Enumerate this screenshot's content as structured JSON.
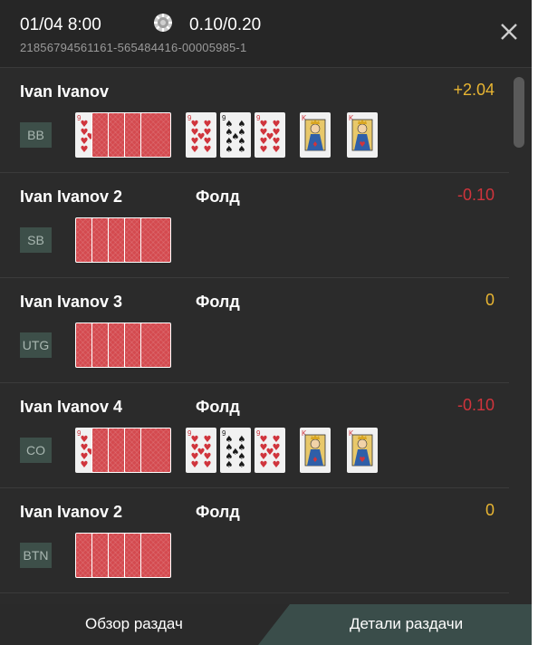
{
  "header": {
    "date": "01/04 8:00",
    "stakes": "0.10/0.20",
    "hand_id": "21856794561161-565484416-00005985-1",
    "chip_icon": "poker-chip-icon",
    "close_icon": "close-icon"
  },
  "players": [
    {
      "name": "Ivan Ivanov",
      "action": "",
      "result": "+2.04",
      "result_color": "#e8b532",
      "position": "BB",
      "hole_revealed": true,
      "board_visible": true
    },
    {
      "name": "Ivan Ivanov 2",
      "action": "Фолд",
      "result": "-0.10",
      "result_color": "#d0343c",
      "position": "SB",
      "hole_revealed": false,
      "board_visible": false
    },
    {
      "name": "Ivan Ivanov 3",
      "action": "Фолд",
      "result": "0",
      "result_color": "#e8b532",
      "position": "UTG",
      "hole_revealed": false,
      "board_visible": false
    },
    {
      "name": "Ivan Ivanov 4",
      "action": "Фолд",
      "result": "-0.10",
      "result_color": "#d0343c",
      "position": "CO",
      "hole_revealed": true,
      "board_visible": true
    },
    {
      "name": "Ivan Ivanov 2",
      "action": "Фолд",
      "result": "0",
      "result_color": "#e8b532",
      "position": "BTN",
      "hole_revealed": false,
      "board_visible": false
    }
  ],
  "board_cards": [
    {
      "rank": "9",
      "suit": "hearts"
    },
    {
      "rank": "9",
      "suit": "spades"
    },
    {
      "rank": "9",
      "suit": "hearts"
    },
    {
      "rank": "K",
      "suit": "diamonds"
    },
    {
      "rank": "K",
      "suit": "hearts"
    }
  ],
  "hole_front_card": {
    "rank": "9",
    "suit": "hearts"
  },
  "tabs": {
    "overview": "Обзор раздач",
    "details": "Детали раздачи",
    "active": "details"
  },
  "colors": {
    "panel_bg": "#2b2b2b",
    "card_back": "#d44a4f",
    "position_badge": "#3d4f49",
    "active_tab": "#3a4d4a"
  }
}
